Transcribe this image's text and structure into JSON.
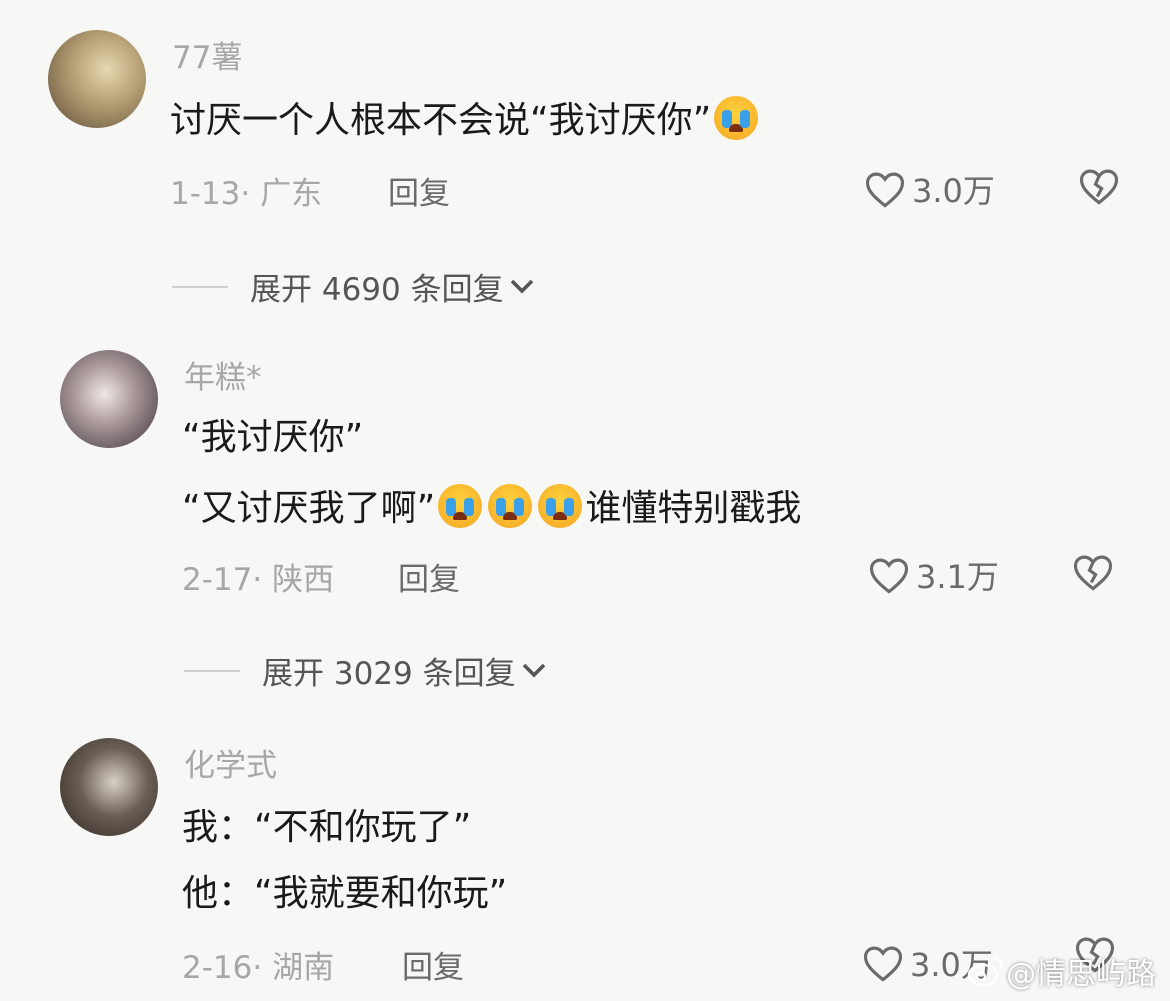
{
  "comments": [
    {
      "username": "77薯",
      "lines": [
        "讨厌一个人根本不会说“我讨厌你”"
      ],
      "date": "1-13",
      "location": "广东",
      "reply_label": "回复",
      "likes": "3.0万",
      "expand_label": "展开 4690 条回复"
    },
    {
      "username": "年糕*",
      "lines": [
        "“我讨厌你”",
        "“又讨厌我了啊”",
        "谁懂特别戳我"
      ],
      "date": "2-17",
      "location": "陕西",
      "reply_label": "回复",
      "likes": "3.1万",
      "expand_label": "展开 3029 条回复"
    },
    {
      "username": "化学式",
      "lines": [
        "我：“不和你玩了”",
        "他：“我就要和你玩”"
      ],
      "date": "2-16",
      "location": "湖南",
      "reply_label": "回复",
      "likes": "3.0万"
    }
  ],
  "watermark": "@情思屿路",
  "icons": {
    "like": "heart-outline-icon",
    "dislike": "broken-heart-icon",
    "expand": "chevron-down-icon",
    "emoji": "loudly-crying-face-emoji"
  }
}
